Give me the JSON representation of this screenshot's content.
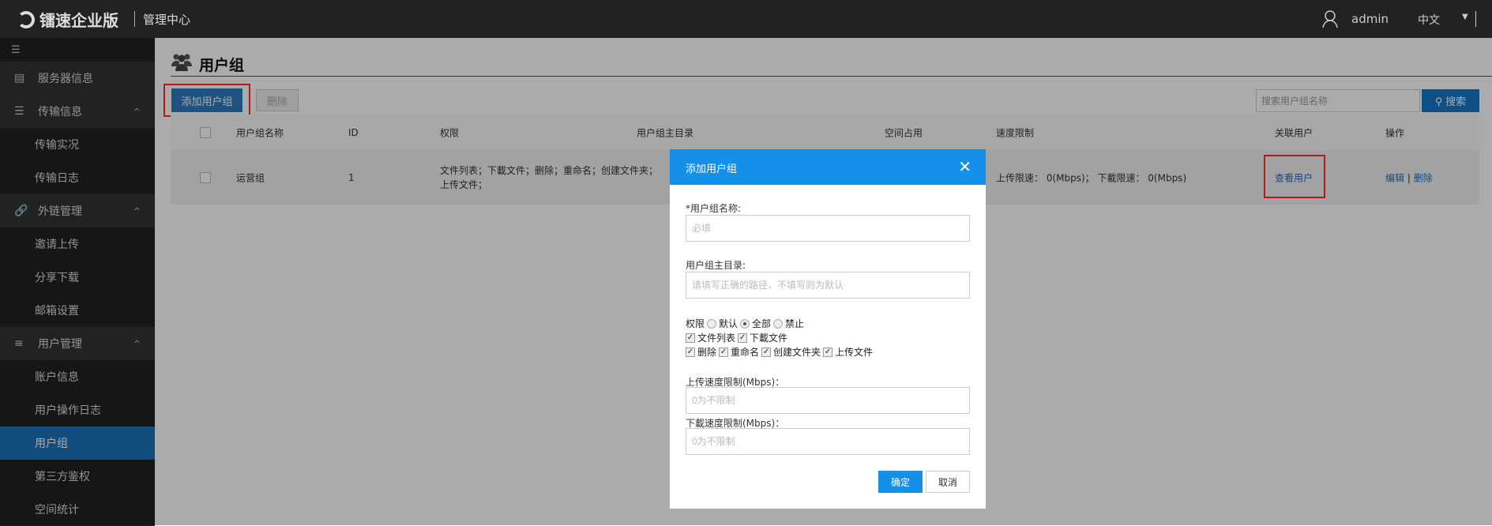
{
  "topbar": {
    "brand": "镭速企业版",
    "subtitle": "管理中心",
    "user": "admin",
    "language": "中文"
  },
  "sidebar": {
    "collapse_icon": "menu-collapse-icon",
    "items": [
      {
        "label": "服务器信息",
        "type": "top",
        "icon": "server-icon"
      },
      {
        "label": "传输信息",
        "type": "header",
        "icon": "list-icon"
      },
      {
        "label": "传输实况",
        "type": "sub"
      },
      {
        "label": "传输日志",
        "type": "sub"
      },
      {
        "label": "外链管理",
        "type": "header",
        "icon": "link-icon"
      },
      {
        "label": "邀请上传",
        "type": "sub"
      },
      {
        "label": "分享下载",
        "type": "sub"
      },
      {
        "label": "邮箱设置",
        "type": "sub"
      },
      {
        "label": "用户管理",
        "type": "header",
        "icon": "user-manage-icon"
      },
      {
        "label": "账户信息",
        "type": "sub"
      },
      {
        "label": "用户操作日志",
        "type": "sub"
      },
      {
        "label": "用户组",
        "type": "sub",
        "active": true
      },
      {
        "label": "第三方鉴权",
        "type": "sub"
      },
      {
        "label": "空间统计",
        "type": "sub"
      }
    ]
  },
  "main": {
    "title": "用户组",
    "add_button": "添加用户组",
    "delete_button": "删除",
    "search_placeholder": "搜索用户组名称",
    "search_button": "搜索",
    "table": {
      "headers": [
        "用户组名称",
        "ID",
        "权限",
        "用户组主目录",
        "空间占用",
        "速度限制",
        "关联用户",
        "操作"
      ],
      "rows": [
        {
          "name": "运营组",
          "id": "1",
          "perm_line1": "文件列表；下載文件；删除；重命名；创建文件夹；",
          "perm_line2": "上传文件；",
          "speed": "上传限速： 0(Mbps)； 下載限速： 0(Mbps)",
          "view_users": "查看用户",
          "edit": "编辑",
          "sep": "|",
          "delete": "删除"
        }
      ]
    }
  },
  "modal": {
    "title": "添加用户组",
    "name_label": "*用户组名称:",
    "name_placeholder": "必填",
    "dir_label": "用户组主目录:",
    "dir_placeholder": "请填写正确的路径，不填写则为默认",
    "perm_label": "权限",
    "perm_radios": [
      {
        "label": "默认",
        "checked": false
      },
      {
        "label": "全部",
        "checked": true
      },
      {
        "label": "禁止",
        "checked": false
      }
    ],
    "perm_checks": [
      "文件列表",
      "下載文件",
      "删除",
      "重命名",
      "创建文件夹",
      "上传文件"
    ],
    "upload_label": "上传速度限制(Mbps)：",
    "upload_placeholder": "0为不限制",
    "download_label": "下載速度限制(Mbps)：",
    "download_placeholder": "0为不限制",
    "ok": "确定",
    "cancel": "取消"
  }
}
